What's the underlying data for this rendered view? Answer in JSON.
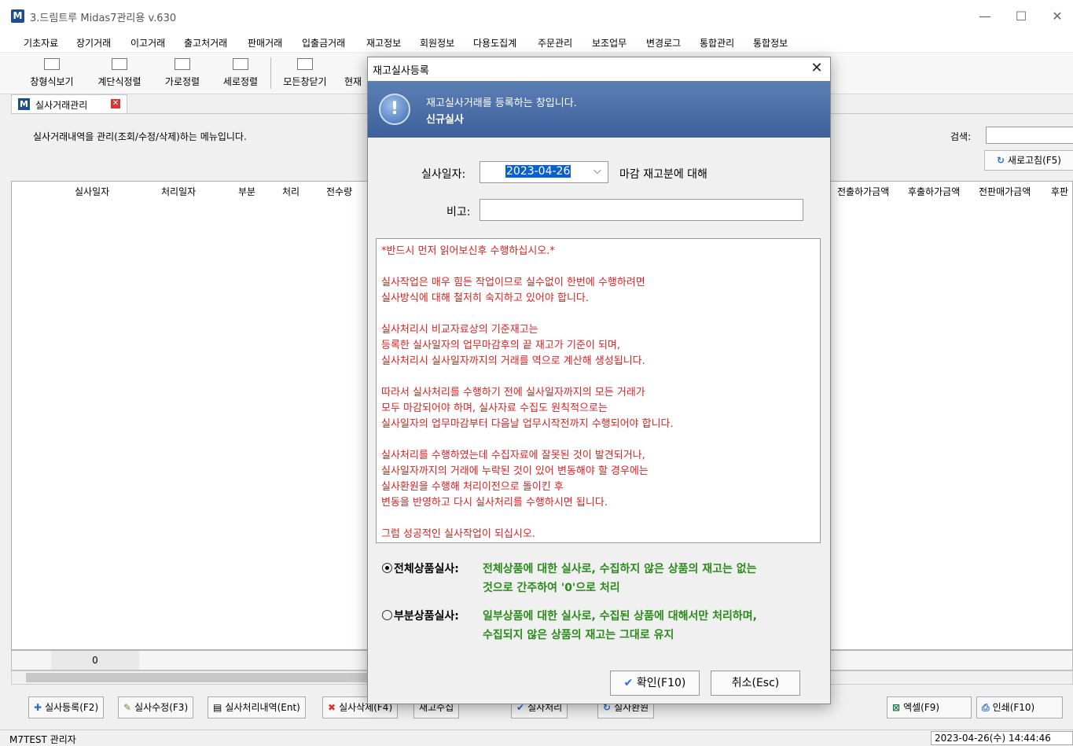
{
  "window": {
    "logo": "M",
    "title": "3.드림트루 Midas7관리용 v.630",
    "minimize": "—",
    "maximize": "☐",
    "close": "✕"
  },
  "menu": [
    "기초자료",
    "장기거래",
    "이고거래",
    "출고처거래",
    "판매거래",
    "입출금거래",
    "재고정보",
    "회원정보",
    "다용도집계",
    "주문관리",
    "보조업무",
    "변경로그",
    "통합관리",
    "통합정보"
  ],
  "toolbar": [
    "창형식보기",
    "계단식정렬",
    "가로정렬",
    "세로정렬",
    "모든창닫기",
    "현재"
  ],
  "doc_tab": {
    "logo": "M",
    "label": "실사거래관리",
    "close": "✕"
  },
  "page": {
    "description": "실사거래내역을 관리(조회/수정/삭제)하는 메뉴입니다.",
    "search_label": "검색:",
    "search_value": "",
    "refresh_label": "새로고침(F5)",
    "refresh_icon": "↻"
  },
  "grid": {
    "columns_left": [
      "실사일자",
      "처리일자",
      "부분",
      "처리",
      "전수량"
    ],
    "columns_right": [
      "전출하가금액",
      "후출하가금액",
      "전판매가금액",
      "후판"
    ],
    "footer_count": "0"
  },
  "bottom_buttons": {
    "add": "실사등록(F2)",
    "edit": "실사수정(F3)",
    "history": "실사처리내역(Ent)",
    "delete": "실사삭제(F4)",
    "collect": "재고수집",
    "process": "실사처리",
    "revert": "실사환원",
    "excel": "엑셀(F9)",
    "print": "인쇄(F10)"
  },
  "status": {
    "user": "M7TEST  관리자",
    "datetime": "2023-04-26(수) 14:44:46"
  },
  "dialog": {
    "title": "재고실사등록",
    "banner_line1": "재고실사거래를 등록하는 창입니다.",
    "banner_line2": "신규실사",
    "date_label": "실사일자:",
    "date_value": "2023-04-26",
    "date_suffix": "마감 재고분에 대해",
    "memo_label": "비고:",
    "memo_value": "",
    "notice": [
      "*반드시 먼저 읽어보신후 수행하십시오.*",
      "",
      "실사작업은 매우 힘든 작업이므로 실수없이 한번에 수행하려면",
      "실사방식에 대해 철저히 숙지하고 있어야 합니다.",
      "",
      "실사처리시 비교자료상의 기준재고는",
      "등록한 실사일자의 업무마감후의 끝 재고가 기준이 되며,",
      "실사처리시 실사일자까지의 거래를 역으로 계산해 생성됩니다.",
      "",
      "따라서 실사처리를 수행하기 전에 실사일자까지의 모든 거래가",
      "모두 마감되어야 하며, 실사자료 수집도 원칙적으로는",
      "실사일자의 업무마감부터 다음날 업무시작전까지 수행되어야 합니다.",
      "",
      "실사처리를 수행하였는데 수집자료에 잘못된 것이 발견되거나,",
      "실사일자까지의 거래에 누락된 것이 있어 변동해야 할 경우에는",
      "실사환원을 수행해 처리이전으로 돌이킨 후",
      "변동을 반영하고 다시 실사처리를 수행하시면 됩니다.",
      "",
      "그럼 성공적인 실사작업이 되십시오."
    ],
    "option_full": {
      "label": "전체상품실사:",
      "desc1": "전체상품에 대한 실사로,  수집하지 않은 상품의 재고는 없는",
      "desc2": "것으로 간주하여 '0'으로 처리",
      "selected": true
    },
    "option_partial": {
      "label": "부분상품실사:",
      "desc1": "일부상품에 대한 실사로, 수집된 상품에 대해서만 처리하며,",
      "desc2": "수집되지 않은 상품의 재고는 그대로 유지",
      "selected": false
    },
    "ok_label": "확인(F10)",
    "cancel_label": "취소(Esc)"
  }
}
